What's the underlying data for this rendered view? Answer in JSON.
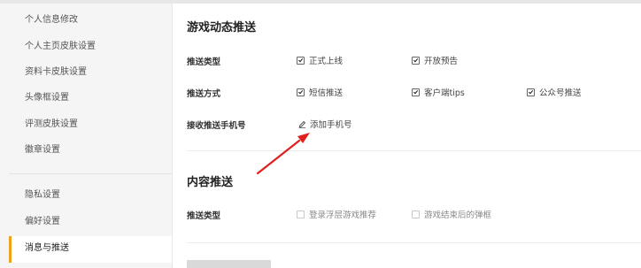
{
  "sidebar": {
    "items": [
      {
        "label": "个人信息修改"
      },
      {
        "label": "个人主页皮肤设置"
      },
      {
        "label": "资料卡皮肤设置"
      },
      {
        "label": "头像框设置"
      },
      {
        "label": "评测皮肤设置"
      },
      {
        "label": "徽章设置"
      },
      {
        "label": "隐私设置"
      },
      {
        "label": "偏好设置"
      },
      {
        "label": "消息与推送",
        "active": true
      }
    ]
  },
  "game_push": {
    "title": "游戏动态推送",
    "push_type_label": "推送类型",
    "push_type_options": [
      {
        "label": "正式上线",
        "checked": true
      },
      {
        "label": "开放预告",
        "checked": true
      }
    ],
    "push_method_label": "推送方式",
    "push_method_options": [
      {
        "label": "短信推送",
        "checked": true
      },
      {
        "label": "客户端tips",
        "checked": true
      },
      {
        "label": "公众号推送",
        "checked": true
      }
    ],
    "phone_label": "接收推送手机号",
    "add_phone_label": "添加手机号"
  },
  "content_push": {
    "title": "内容推送",
    "push_type_label": "推送类型",
    "push_type_options": [
      {
        "label": "登录浮层游戏推荐",
        "checked": false
      },
      {
        "label": "游戏结束后的弹框",
        "checked": false
      }
    ]
  },
  "colors": {
    "accent": "#f2a21a",
    "arrow": "#e02020"
  }
}
